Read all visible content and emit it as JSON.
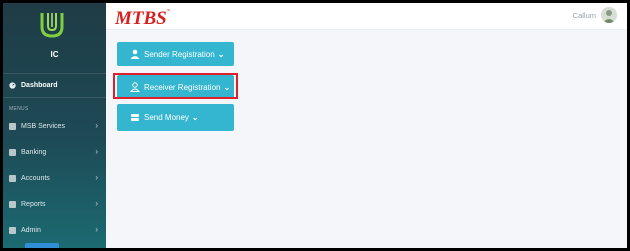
{
  "sidebar": {
    "org_name": "IC",
    "dashboard_label": "Dashboard",
    "menus_label": "MENUS",
    "items": [
      {
        "label": "MSB Services"
      },
      {
        "label": "Banking"
      },
      {
        "label": "Accounts"
      },
      {
        "label": "Reports"
      },
      {
        "label": "Admin"
      }
    ]
  },
  "header": {
    "brand": "MTBS",
    "user_name": "Callum"
  },
  "main": {
    "buttons": [
      {
        "label": "Sender Registration"
      },
      {
        "label": "Receiver Registration"
      },
      {
        "label": "Send Money"
      }
    ]
  },
  "colors": {
    "button": "#34b6d0",
    "highlight": "#e01f2a",
    "brand_red": "#d6201f"
  }
}
